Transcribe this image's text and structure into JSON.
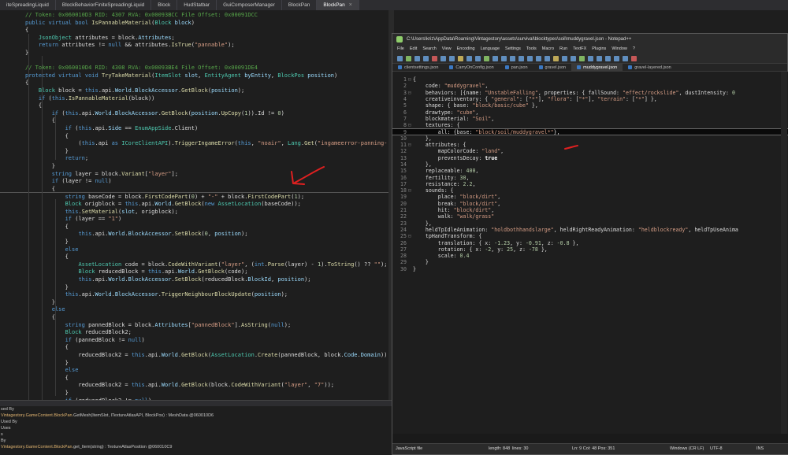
{
  "ide_tabs": [
    "iteSpreadingLiquid",
    "BlockBehaviorFiniteSpreadingLiquid",
    "Block",
    "HudStatbar",
    "GuiComposerManager",
    "BlockPan",
    "BlockPan"
  ],
  "ide_tab_close": "×",
  "cs_code": [
    {
      "t": "cm",
      "text": "// Token: 0x060010D3 RID: 4307 RVA: 0x00093BCC File Offset: 0x00091DCC"
    },
    {
      "t": "code",
      "html": "<span class='kw'>public virtual bool</span> <span class='fn'>IsPannableMaterial</span>(<span class='ty'>Block</span> <span class='pr'>block</span>)"
    },
    {
      "t": "code",
      "html": "{"
    },
    {
      "t": "code",
      "html": "    <span class='ty'>JsonObject</span> attributes = block.<span class='pr'>Attributes</span>;"
    },
    {
      "t": "code",
      "html": "    <span class='kw'>return</span> attributes != <span class='kw'>null</span> &amp;&amp; attributes.<span class='fn'>IsTrue</span>(<span class='st'>\"pannable\"</span>);"
    },
    {
      "t": "code",
      "html": "}"
    },
    {
      "t": "blank"
    },
    {
      "t": "cm",
      "text": "// Token: 0x060010D4 RID: 4308 RVA: 0x00093BE4 File Offset: 0x00091DE4"
    },
    {
      "t": "code",
      "html": "<span class='kw'>protected virtual void</span> <span class='fn'>TryTakeMaterial</span>(<span class='ty'>ItemSlot</span> <span class='pr'>slot</span>, <span class='ty'>EntityAgent</span> <span class='pr'>byEntity</span>, <span class='ty'>BlockPos</span> <span class='pr'>position</span>)"
    },
    {
      "t": "code",
      "html": "{"
    },
    {
      "t": "code",
      "html": "    <span class='ty'>Block</span> block = <span class='kw'>this</span>.api.<span class='pr'>World</span>.<span class='pr'>BlockAccessor</span>.<span class='fn'>GetBlock</span>(<span class='pr'>position</span>);"
    },
    {
      "t": "code",
      "html": "    <span class='kw'>if</span> (<span class='kw'>this</span>.<span class='fn'>IsPannableMaterial</span>(block))"
    },
    {
      "t": "code",
      "html": "    {"
    },
    {
      "t": "code",
      "html": "        <span class='kw'>if</span> (<span class='kw'>this</span>.api.<span class='pr'>World</span>.<span class='pr'>BlockAccessor</span>.<span class='fn'>GetBlock</span>(<span class='pr'>position</span>.<span class='fn'>UpCopy</span>(<span class='nm'>1</span>)).Id != <span class='nm'>0</span>)"
    },
    {
      "t": "code",
      "html": "        {"
    },
    {
      "t": "code",
      "html": "            <span class='kw'>if</span> (<span class='kw'>this</span>.api.<span class='pr'>Side</span> == <span class='ty'>EnumAppSide</span>.Client)"
    },
    {
      "t": "code",
      "html": "            {"
    },
    {
      "t": "code",
      "html": "                (<span class='kw'>this</span>.api <span class='kw'>as</span> <span class='ty'>ICoreClientAPI</span>).<span class='fn'>TriggerIngameError</span>(<span class='kw'>this</span>, <span class='st'>\"noair\"</span>, <span class='ty'>Lang</span>.<span class='fn'>Get</span>(<span class='st'>\"ingameerror-panning-</span>"
    },
    {
      "t": "code",
      "html": "            }"
    },
    {
      "t": "code",
      "html": "            <span class='kw'>return</span>;"
    },
    {
      "t": "code",
      "html": "        }"
    },
    {
      "t": "code",
      "html": "        <span class='kw'>string</span> layer = block.<span class='fn'>Variant</span>[<span class='st'>\"layer\"</span>];"
    },
    {
      "t": "code",
      "html": "        <span class='kw'>if</span> (layer != <span class='kw'>null</span>)"
    },
    {
      "t": "code",
      "html": "        {"
    },
    {
      "t": "code",
      "sep": true,
      "html": "            <span class='kw'>string</span> baseCode = block.<span class='fn'>FirstCodePart</span>(<span class='nm'>0</span>) + <span class='st'>\"-\"</span> + block.<span class='fn'>FirstCodePart</span>(<span class='nm'>1</span>);"
    },
    {
      "t": "code",
      "html": "            <span class='ty'>Block</span> origblock = <span class='kw'>this</span>.api.<span class='pr'>World</span>.<span class='fn'>GetBlock</span>(<span class='kw'>new</span> <span class='ty'>AssetLocation</span>(baseCode));"
    },
    {
      "t": "code",
      "html": "            <span class='kw'>this</span>.<span class='fn'>SetMaterial</span>(<span class='pr'>slot</span>, origblock);"
    },
    {
      "t": "code",
      "html": "            <span class='kw'>if</span> (layer == <span class='st'>\"1\"</span>)"
    },
    {
      "t": "code",
      "html": "            {"
    },
    {
      "t": "code",
      "html": "                <span class='kw'>this</span>.api.<span class='pr'>World</span>.<span class='pr'>BlockAccessor</span>.<span class='fn'>SetBlock</span>(<span class='nm'>0</span>, <span class='pr'>position</span>);"
    },
    {
      "t": "code",
      "html": "            }"
    },
    {
      "t": "code",
      "html": "            <span class='kw'>else</span>"
    },
    {
      "t": "code",
      "html": "            {"
    },
    {
      "t": "code",
      "html": "                <span class='ty'>AssetLocation</span> code = block.<span class='fn'>CodeWithVariant</span>(<span class='st'>\"layer\"</span>, (<span class='kw'>int</span>.<span class='fn'>Parse</span>(layer) - <span class='nm'>1</span>).<span class='fn'>ToString</span>() ?? <span class='st'>\"\"</span>);"
    },
    {
      "t": "code",
      "html": "                <span class='ty'>Block</span> reducedBlock = <span class='kw'>this</span>.api.<span class='pr'>World</span>.<span class='fn'>GetBlock</span>(code);"
    },
    {
      "t": "code",
      "html": "                <span class='kw'>this</span>.api.<span class='pr'>World</span>.<span class='pr'>BlockAccessor</span>.<span class='fn'>SetBlock</span>(reducedBlock.<span class='pr'>BlockId</span>, <span class='pr'>position</span>);"
    },
    {
      "t": "code",
      "html": "            }"
    },
    {
      "t": "code",
      "html": "            <span class='kw'>this</span>.api.<span class='pr'>World</span>.<span class='pr'>BlockAccessor</span>.<span class='fn'>TriggerNeighbourBlockUpdate</span>(<span class='pr'>position</span>);"
    },
    {
      "t": "code",
      "html": "        }"
    },
    {
      "t": "code",
      "html": "        <span class='kw'>else</span>"
    },
    {
      "t": "code",
      "html": "        {"
    },
    {
      "t": "code",
      "html": "            <span class='kw'>string</span> pannedBlock = block.<span class='pr'>Attributes</span>[<span class='st'>\"pannedBlock\"</span>].<span class='fn'>AsString</span>(<span class='kw'>null</span>);"
    },
    {
      "t": "code",
      "html": "            <span class='ty'>Block</span> reducedBlock2;"
    },
    {
      "t": "code",
      "html": "            <span class='kw'>if</span> (pannedBlock != <span class='kw'>null</span>)"
    },
    {
      "t": "code",
      "html": "            {"
    },
    {
      "t": "code",
      "html": "                reducedBlock2 = <span class='kw'>this</span>.api.<span class='pr'>World</span>.<span class='fn'>GetBlock</span>(<span class='ty'>AssetLocation</span>.<span class='fn'>Create</span>(pannedBlock, block.<span class='pr'>Code</span>.<span class='pr'>Domain</span>))"
    },
    {
      "t": "code",
      "html": "            }"
    },
    {
      "t": "code",
      "html": "            <span class='kw'>else</span>"
    },
    {
      "t": "code",
      "html": "            {"
    },
    {
      "t": "code",
      "html": "                reducedBlock2 = <span class='kw'>this</span>.api.<span class='pr'>World</span>.<span class='fn'>GetBlock</span>(block.<span class='fn'>CodeWithVariant</span>(<span class='st'>\"layer\"</span>, <span class='st'>\"7\"</span>));"
    },
    {
      "t": "code",
      "html": "            }"
    },
    {
      "t": "code",
      "html": "            <span class='kw'>if</span> (reducedBlock2 != <span class='kw'>null</span>)"
    },
    {
      "t": "code",
      "html": "            {"
    }
  ],
  "bottom_panel": [
    {
      "text": "sed By",
      "ns": ""
    },
    {
      "ns": "Vintagestory.GameContent.BlockPan.",
      "text": "GetMesh(ItemSlot, ITextureAtlasAPI, BlockPos) : MeshData @060010D6"
    },
    {
      "text": "  Used By",
      "ns": ""
    },
    {
      "text": "  Uses",
      "ns": ""
    },
    {
      "text": "s",
      "ns": ""
    },
    {
      "text": "By",
      "ns": ""
    },
    {
      "ns": "Vintagestory.GameContent.BlockPan.",
      "text": "get_Item(string) : TextureAtlasPosition @060010C9"
    }
  ],
  "notepad": {
    "title": "C:\\Users\\kriz\\AppData\\Roaming\\Vintagestory\\assets\\survival\\blocktypes\\soil\\muddygravel.json - Notepad++",
    "menu": [
      "File",
      "Edit",
      "Search",
      "View",
      "Encoding",
      "Language",
      "Settings",
      "Tools",
      "Macro",
      "Run",
      "TextFX",
      "Plugins",
      "Window",
      "?"
    ],
    "tabs": [
      "clientsettings.json",
      "CarryOnConfig.json",
      "pan.json",
      "gravel.json",
      "muddygravel.json",
      "gravel-layered.json"
    ],
    "active_tab": 4,
    "lines": [
      "{",
      "    code: \"muddygravel\",",
      "    behaviors: [{name: \"UnstableFalling\", properties: { fallSound: \"effect/rockslide\", dustIntensity: 0",
      "    creativeinventory: { \"general\": [\"*\"], \"flora\": [\"*\"], \"terrain\": [\"*\"] },",
      "    shape: { base: \"block/basic/cube\" },",
      "    drawtype: \"cube\",",
      "    blockmaterial: \"Soil\",",
      "    textures: {",
      "        all: {base: \"block/soil/muddygravel*\"},",
      "    },",
      "    attributes: {",
      "        mapColorCode: \"land\",",
      "        preventsDecay: true",
      "    },",
      "    replaceable: 400,",
      "    fertility: 30,",
      "    resistance: 2.2,",
      "    sounds: {",
      "        place: \"block/dirt\",",
      "        break: \"block/dirt\",",
      "        hit: \"block/dirt\",",
      "        walk: \"walk/grass\"",
      "    },",
      "    heldTpIdleAnimation: \"holdbothhandslarge\", heldRightReadyAnimation: \"heldblockready\", heldTpUseAnima",
      "    tpHandTransform: {",
      "        translation: { x: -1.23, y: -0.91, z: -0.8 },",
      "        rotation: { x: -2, y: 25, z: -78 },",
      "        scale: 0.4",
      "    }",
      "}"
    ],
    "current_line": 9,
    "status": {
      "lang": "JavaScript file",
      "length": "length: 848",
      "lines": "lines: 30",
      "pos": "Ln: 9    Col: 48    Pos: 351",
      "eol": "Windows (CR LF)",
      "enc": "UTF-8",
      "mode": "INS"
    }
  },
  "colors": {
    "annotation": "#e02020",
    "editor_bg": "#1e1e1e",
    "comment": "#57a64a",
    "keyword": "#569cd6"
  }
}
